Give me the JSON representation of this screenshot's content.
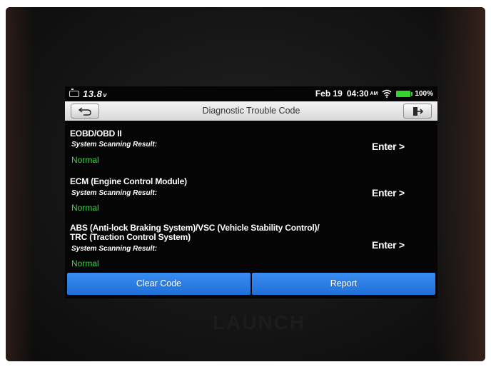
{
  "status": {
    "voltage": "13.8",
    "voltage_unit": "v",
    "date": "Feb 19",
    "time": "04:30",
    "ampm": "AM",
    "battery_percent": "100%"
  },
  "header": {
    "title": "Diagnostic Trouble Code"
  },
  "systems": [
    {
      "name_lines": [
        "EOBD/OBD II"
      ],
      "scan_label": "System Scanning Result:",
      "result": "Normal",
      "enter_label": "Enter >"
    },
    {
      "name_lines": [
        "ECM (Engine Control Module)"
      ],
      "scan_label": "System Scanning Result:",
      "result": "Normal",
      "enter_label": "Enter >"
    },
    {
      "name_lines": [
        "ABS (Anti-lock Braking System)/VSC (Vehicle Stability Control)/",
        "TRC (Traction Control System)"
      ],
      "scan_label": "System Scanning Result:",
      "result": "Normal",
      "enter_label": "Enter >"
    }
  ],
  "footer": {
    "clear_code_label": "Clear Code",
    "report_label": "Report"
  },
  "device": {
    "brand": "LAUNCH"
  },
  "colors": {
    "normal_status": "#3fd24a",
    "button_blue": "#2a7de6",
    "battery": "#38d22e"
  },
  "icons": [
    "battery-car-icon",
    "wifi-icon",
    "battery-icon",
    "back-arrow-icon",
    "exit-icon"
  ]
}
